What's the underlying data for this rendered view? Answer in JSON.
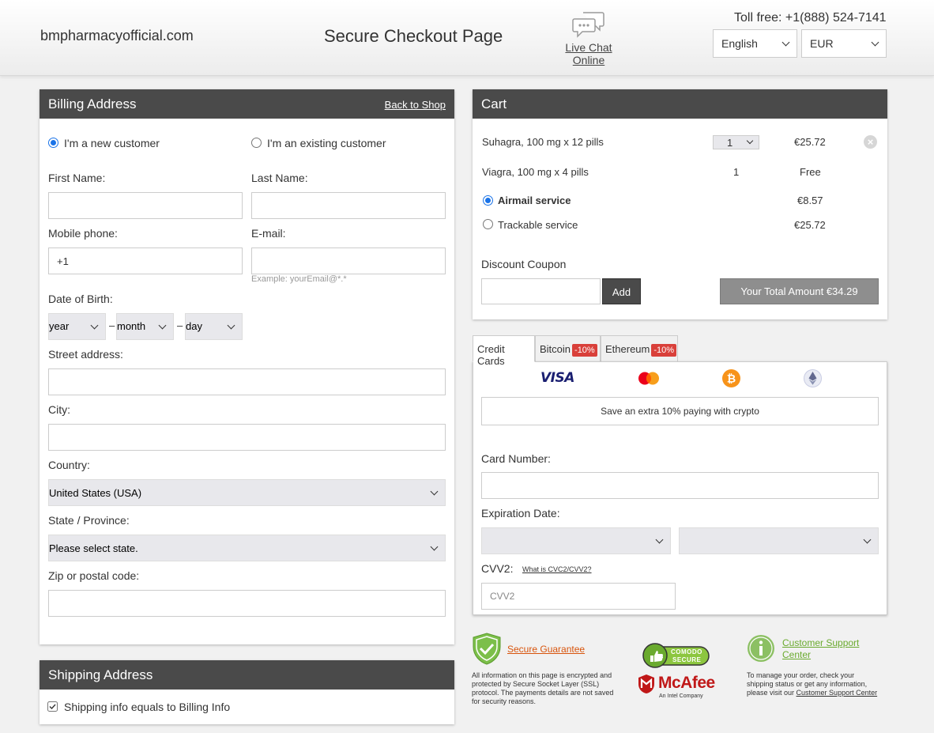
{
  "header": {
    "site_name": "bmpharmacyofficial.com",
    "page_title": "Secure Checkout Page",
    "chat_label": "Live Chat Online",
    "toll_free": "Toll free: +1(888) 524-7141",
    "language": "English",
    "currency": "EUR"
  },
  "billing": {
    "title": "Billing Address",
    "back_link": "Back to Shop",
    "new_customer": "I'm a new customer",
    "existing_customer": "I'm an existing customer",
    "first_name_label": "First Name:",
    "last_name_label": "Last Name:",
    "mobile_label": "Mobile phone:",
    "mobile_value": "+1",
    "email_label": "E-mail:",
    "email_hint": "Example: yourEmail@*.*",
    "dob_label": "Date of Birth:",
    "dob_year": "year",
    "dob_month": "month",
    "dob_day": "day",
    "dob_sep": "–",
    "street_label": "Street address:",
    "city_label": "City:",
    "country_label": "Country:",
    "country_value": "United States (USA)",
    "state_label": "State / Province:",
    "state_value": "Please select state.",
    "zip_label": "Zip or postal code:"
  },
  "shipping": {
    "title": "Shipping Address",
    "same_as_billing": "Shipping info equals to Billing Info"
  },
  "cart": {
    "title": "Cart",
    "items": [
      {
        "name": "Suhagra, 100 mg x 12 pills",
        "qty": "1",
        "price": "€25.72"
      },
      {
        "name": "Viagra, 100 mg x 4 pills",
        "qty": "1",
        "price": "Free"
      }
    ],
    "shipping_options": [
      {
        "name": "Airmail service",
        "price": "€8.57",
        "selected": true
      },
      {
        "name": "Trackable service",
        "price": "€25.72",
        "selected": false
      }
    ],
    "coupon_label": "Discount Coupon",
    "add_button": "Add",
    "total_button": "Your Total Amount €34.29"
  },
  "payment": {
    "tabs": [
      {
        "label": "Credit Cards",
        "badge": ""
      },
      {
        "label": "Bitcoin",
        "badge": "-10%"
      },
      {
        "label": "Ethereum",
        "badge": "-10%"
      }
    ],
    "visa_text": "VISA",
    "crypto_note": "Save an extra 10% paying with crypto",
    "card_number_label": "Card Number:",
    "expiration_label": "Expiration Date:",
    "cvv_label": "CVV2:",
    "cvv_help": "What is CVC2/CVV2?",
    "cvv_placeholder": "CVV2"
  },
  "footer": {
    "secure_title": "Secure Guarantee",
    "secure_text": "All information on this page is encrypted and protected by Secure Socket Layer (SSL) protocol. The payments details are not saved for security reasons.",
    "comodo_line1": "COMODO",
    "comodo_line2": "SECURE",
    "mcafee": "McAfee",
    "mcafee_sub": "An Intel Company",
    "support_title": "Customer Support Center",
    "support_text": "To manage your order, check your shipping status or get any information, please visit our",
    "support_link": "Customer Support Center"
  },
  "colors": {
    "panel_header": "#4a4a4a",
    "accent_radio": "#1a73e8",
    "secure_orange": "#d8540c",
    "support_green": "#6aaa2e",
    "badge_red": "#d9403a"
  }
}
